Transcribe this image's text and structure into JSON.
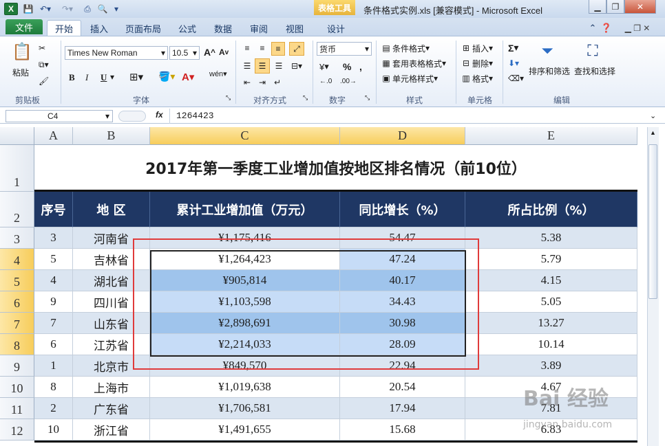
{
  "app": {
    "title": "条件格式实例.xls  [兼容模式]  -  Microsoft Excel",
    "context_tab_group": "表格工具",
    "logo_letter": "X"
  },
  "tabs": {
    "file": "文件",
    "items": [
      "开始",
      "插入",
      "页面布局",
      "公式",
      "数据",
      "审阅",
      "视图",
      "设计"
    ]
  },
  "ribbon": {
    "clipboard": {
      "paste": "粘贴",
      "label": "剪贴板"
    },
    "font": {
      "name": "Times New Roman",
      "size": "10.5",
      "label": "字体",
      "bold": "B",
      "italic": "I",
      "underline": "U",
      "grow": "A",
      "shrink": "A"
    },
    "alignment": {
      "label": "对齐方式"
    },
    "number": {
      "format": "货币",
      "label": "数字",
      "percent": "%",
      "comma": ",",
      "currency": "¥"
    },
    "styles": {
      "conditional": "条件格式",
      "table": "套用表格格式",
      "cell": "单元格样式",
      "label": "样式"
    },
    "cells": {
      "insert": "插入",
      "delete": "删除",
      "format": "格式",
      "label": "单元格"
    },
    "editing": {
      "sort": "排序和筛选",
      "find": "查找和选择",
      "label": "编辑",
      "sum": "Σ"
    }
  },
  "formula_bar": {
    "name_box": "C4",
    "fx": "fx",
    "value": "1264423"
  },
  "grid": {
    "columns": [
      "A",
      "B",
      "C",
      "D",
      "E"
    ],
    "selected_columns": [
      "C",
      "D"
    ],
    "title": "2017年第一季度工业增加值按地区排名情况（前10位）",
    "headers": [
      "序号",
      "地 区",
      "累计工业增加值（万元）",
      "同比增长（%）",
      "所占比例（%）"
    ],
    "rows": [
      {
        "num": "3",
        "seq": "3",
        "region": "河南省",
        "value": "¥1,175,416",
        "growth": "54.47",
        "share": "5.38"
      },
      {
        "num": "4",
        "seq": "5",
        "region": "吉林省",
        "value": "¥1,264,423",
        "growth": "47.24",
        "share": "5.79"
      },
      {
        "num": "5",
        "seq": "4",
        "region": "湖北省",
        "value": "¥905,814",
        "growth": "40.17",
        "share": "4.15"
      },
      {
        "num": "6",
        "seq": "9",
        "region": "四川省",
        "value": "¥1,103,598",
        "growth": "34.43",
        "share": "5.05"
      },
      {
        "num": "7",
        "seq": "7",
        "region": "山东省",
        "value": "¥2,898,691",
        "growth": "30.98",
        "share": "13.27"
      },
      {
        "num": "8",
        "seq": "6",
        "region": "江苏省",
        "value": "¥2,214,033",
        "growth": "28.09",
        "share": "10.14"
      },
      {
        "num": "9",
        "seq": "1",
        "region": "北京市",
        "value": "¥849,570",
        "growth": "22.94",
        "share": "3.89"
      },
      {
        "num": "10",
        "seq": "8",
        "region": "上海市",
        "value": "¥1,019,638",
        "growth": "20.54",
        "share": "4.67"
      },
      {
        "num": "11",
        "seq": "2",
        "region": "广东省",
        "value": "¥1,706,581",
        "growth": "17.94",
        "share": "7.81"
      },
      {
        "num": "12",
        "seq": "10",
        "region": "浙江省",
        "value": "¥1,491,655",
        "growth": "15.68",
        "share": "6.83"
      }
    ],
    "title_row": "1",
    "header_row": "2"
  },
  "colors": {
    "header_bg": "#1f3764",
    "band_bg": "#dbe5f1",
    "selection_fill": "#c6dcf7",
    "selection_dark": "#9fc4ec",
    "highlight_outline": "#e03a3a"
  },
  "watermark": {
    "brand": "Bai 经验",
    "url": "jingyan.baidu.com"
  }
}
